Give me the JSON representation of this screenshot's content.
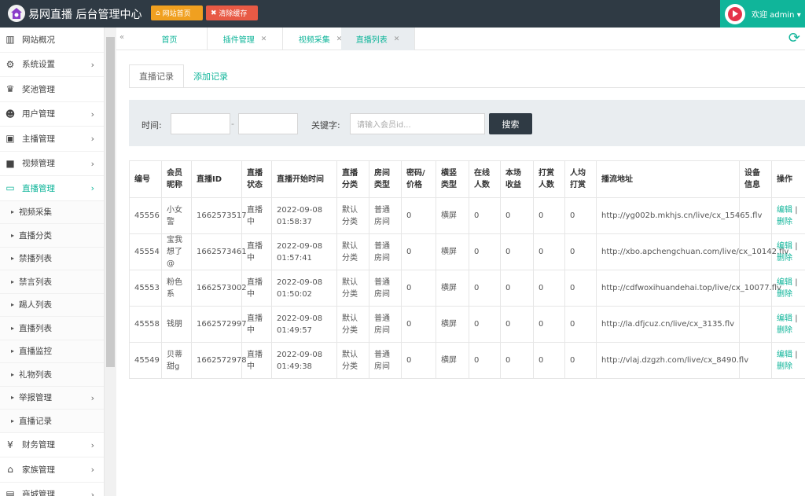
{
  "header": {
    "brand": "易网直播 后台管理中心",
    "btn_home": "网站首页",
    "btn_cache": "清除缓存",
    "welcome": "欢迎 admin ▾"
  },
  "sidebar": {
    "items": [
      {
        "label": "网站概况",
        "icon": "bar-chart-icon",
        "chev": ""
      },
      {
        "label": "系统设置",
        "icon": "gears-icon",
        "chev": "›"
      },
      {
        "label": "奖池管理",
        "icon": "trophy-icon",
        "chev": ""
      },
      {
        "label": "用户管理",
        "icon": "users-icon",
        "chev": "›"
      },
      {
        "label": "主播管理",
        "icon": "id-card-icon",
        "chev": "›"
      },
      {
        "label": "视频管理",
        "icon": "video-camera-icon",
        "chev": "›"
      },
      {
        "label": "直播管理",
        "icon": "monitor-icon",
        "chev": "›"
      }
    ],
    "subitems": [
      {
        "label": "视频采集",
        "chev": ""
      },
      {
        "label": "直播分类",
        "chev": ""
      },
      {
        "label": "禁播列表",
        "chev": ""
      },
      {
        "label": "禁言列表",
        "chev": ""
      },
      {
        "label": "踢人列表",
        "chev": ""
      },
      {
        "label": "直播列表",
        "chev": ""
      },
      {
        "label": "直播监控",
        "chev": ""
      },
      {
        "label": "礼物列表",
        "chev": ""
      },
      {
        "label": "举报管理",
        "chev": "›"
      },
      {
        "label": "直播记录",
        "chev": ""
      }
    ],
    "bottom_items": [
      {
        "label": "财务管理",
        "icon": "yen-icon",
        "chev": "›"
      },
      {
        "label": "家族管理",
        "icon": "bank-icon",
        "chev": "›"
      },
      {
        "label": "商城管理",
        "icon": "cart-icon",
        "chev": "›"
      }
    ]
  },
  "tabs": [
    {
      "label": "首页"
    },
    {
      "label": "插件管理"
    },
    {
      "label": "视频采集"
    },
    {
      "label": "直播列表"
    }
  ],
  "subtabs": [
    "直播记录",
    "添加记录"
  ],
  "search": {
    "time_label": "时间:",
    "dash": "-",
    "keyword_label": "关键字:",
    "keyword_placeholder": "请输入会员id...",
    "button": "搜索"
  },
  "table": {
    "headers": [
      "编号",
      "会员昵称",
      "直播ID",
      "直播状态",
      "直播开始时间",
      "直播分类",
      "房间类型",
      "密码/价格",
      "横竖类型",
      "在线人数",
      "本场收益",
      "打赏人数",
      "人均打赏",
      "播流地址",
      "设备信息",
      "操作"
    ],
    "rows": [
      [
        "45556",
        "小女警",
        "1662573517",
        "直播中",
        "2022-09-08 01:58:37",
        "默认分类",
        "普通房间",
        "0",
        "横屏",
        "0",
        "0",
        "0",
        "0",
        "http://yg002b.mkhjs.cn/live/cx_15465.flv",
        ""
      ],
      [
        "45554",
        "宝我想了@",
        "1662573461",
        "直播中",
        "2022-09-08 01:57:41",
        "默认分类",
        "普通房间",
        "0",
        "横屏",
        "0",
        "0",
        "0",
        "0",
        "http://xbo.apchengchuan.com/live/cx_10142.flv",
        ""
      ],
      [
        "45553",
        "粉色系",
        "1662573002",
        "直播中",
        "2022-09-08 01:50:02",
        "默认分类",
        "普通房间",
        "0",
        "横屏",
        "0",
        "0",
        "0",
        "0",
        "http://cdfwoxihuandehai.top/live/cx_10077.flv",
        ""
      ],
      [
        "45558",
        "钱朋",
        "1662572997",
        "直播中",
        "2022-09-08 01:49:57",
        "默认分类",
        "普通房间",
        "0",
        "横屏",
        "0",
        "0",
        "0",
        "0",
        "http://la.dfjcuz.cn/live/cx_3135.flv",
        ""
      ],
      [
        "45549",
        "贝蒂甜g",
        "1662572978",
        "直播中",
        "2022-09-08 01:49:38",
        "默认分类",
        "普通房间",
        "0",
        "横屏",
        "0",
        "0",
        "0",
        "0",
        "http://vlaj.dzgzh.com/live/cx_8490.flv",
        ""
      ]
    ],
    "op_edit": "编辑",
    "op_sep": "|",
    "op_delete": "删除"
  },
  "colors": {
    "accent": "#10b59a",
    "topbar": "#2f3a44",
    "orange": "#f0a020",
    "red": "#e85a45"
  }
}
